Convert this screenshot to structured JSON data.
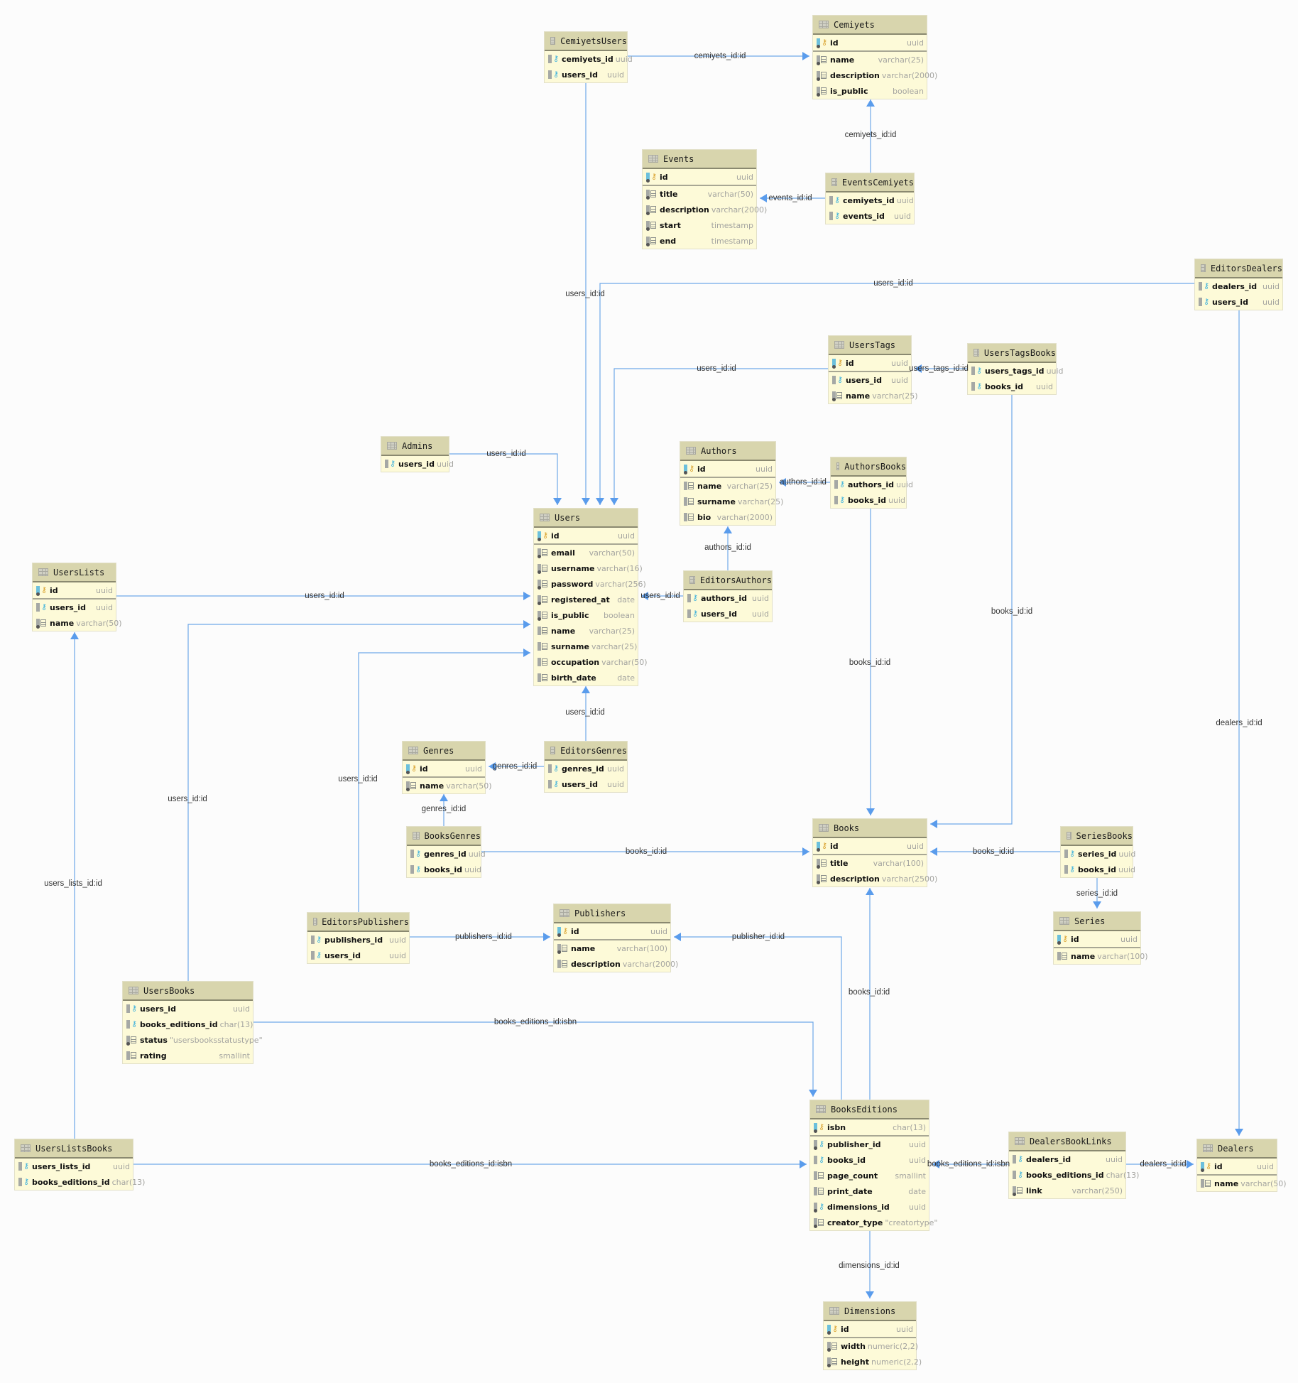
{
  "diagram": {
    "type": "database-er-diagram",
    "colors": {
      "edge": "#6fa8e8",
      "arrow": "#5a9cec",
      "header": "#d8d5ad",
      "body": "#fdfad8"
    },
    "tables": [
      {
        "name": "CemiyetsUsers",
        "columns": [
          {
            "name": "cemiyets_id",
            "type": "uuid",
            "kind": "fk"
          },
          {
            "name": "users_id",
            "type": "uuid",
            "kind": "fk"
          }
        ]
      },
      {
        "name": "Cemiyets",
        "columns": [
          {
            "name": "id",
            "type": "uuid",
            "kind": "pk"
          },
          {
            "name": "name",
            "type": "varchar(25)",
            "kind": "col-req"
          },
          {
            "name": "description",
            "type": "varchar(2000)",
            "kind": "col-req"
          },
          {
            "name": "is_public",
            "type": "boolean",
            "kind": "col-req"
          }
        ]
      },
      {
        "name": "Events",
        "columns": [
          {
            "name": "id",
            "type": "uuid",
            "kind": "pk"
          },
          {
            "name": "title",
            "type": "varchar(50)",
            "kind": "col-req"
          },
          {
            "name": "description",
            "type": "varchar(2000)",
            "kind": "col-req"
          },
          {
            "name": "start",
            "type": "timestamp",
            "kind": "col-req"
          },
          {
            "name": "end",
            "type": "timestamp",
            "kind": "col-req"
          }
        ]
      },
      {
        "name": "EventsCemiyets",
        "columns": [
          {
            "name": "cemiyets_id",
            "type": "uuid",
            "kind": "fk"
          },
          {
            "name": "events_id",
            "type": "uuid",
            "kind": "fk"
          }
        ]
      },
      {
        "name": "EditorsDealers",
        "columns": [
          {
            "name": "dealers_id",
            "type": "uuid",
            "kind": "fk"
          },
          {
            "name": "users_id",
            "type": "uuid",
            "kind": "fk"
          }
        ]
      },
      {
        "name": "UsersTags",
        "columns": [
          {
            "name": "id",
            "type": "uuid",
            "kind": "pk"
          },
          {
            "name": "users_id",
            "type": "uuid",
            "kind": "fk"
          },
          {
            "name": "name",
            "type": "varchar(25)",
            "kind": "col-req"
          }
        ]
      },
      {
        "name": "UsersTagsBooks",
        "columns": [
          {
            "name": "users_tags_id",
            "type": "uuid",
            "kind": "fk"
          },
          {
            "name": "books_id",
            "type": "uuid",
            "kind": "fk"
          }
        ]
      },
      {
        "name": "Admins",
        "columns": [
          {
            "name": "users_id",
            "type": "uuid",
            "kind": "fk"
          }
        ]
      },
      {
        "name": "Authors",
        "columns": [
          {
            "name": "id",
            "type": "uuid",
            "kind": "pk"
          },
          {
            "name": "name",
            "type": "varchar(25)",
            "kind": "col"
          },
          {
            "name": "surname",
            "type": "varchar(25)",
            "kind": "col"
          },
          {
            "name": "bio",
            "type": "varchar(2000)",
            "kind": "col"
          }
        ]
      },
      {
        "name": "AuthorsBooks",
        "columns": [
          {
            "name": "authors_id",
            "type": "uuid",
            "kind": "fk"
          },
          {
            "name": "books_id",
            "type": "uuid",
            "kind": "fk"
          }
        ]
      },
      {
        "name": "Users",
        "columns": [
          {
            "name": "id",
            "type": "uuid",
            "kind": "pk"
          },
          {
            "name": "email",
            "type": "varchar(50)",
            "kind": "col-req"
          },
          {
            "name": "username",
            "type": "varchar(16)",
            "kind": "col-req"
          },
          {
            "name": "password",
            "type": "varchar(256)",
            "kind": "col-req"
          },
          {
            "name": "registered_at",
            "type": "date",
            "kind": "col-req"
          },
          {
            "name": "is_public",
            "type": "boolean",
            "kind": "col-req"
          },
          {
            "name": "name",
            "type": "varchar(25)",
            "kind": "col"
          },
          {
            "name": "surname",
            "type": "varchar(25)",
            "kind": "col"
          },
          {
            "name": "occupation",
            "type": "varchar(50)",
            "kind": "col"
          },
          {
            "name": "birth_date",
            "type": "date",
            "kind": "col"
          }
        ]
      },
      {
        "name": "EditorsAuthors",
        "columns": [
          {
            "name": "authors_id",
            "type": "uuid",
            "kind": "fk"
          },
          {
            "name": "users_id",
            "type": "uuid",
            "kind": "fk"
          }
        ]
      },
      {
        "name": "UsersLists",
        "columns": [
          {
            "name": "id",
            "type": "uuid",
            "kind": "pk"
          },
          {
            "name": "users_id",
            "type": "uuid",
            "kind": "fk"
          },
          {
            "name": "name",
            "type": "varchar(50)",
            "kind": "col-req"
          }
        ]
      },
      {
        "name": "Genres",
        "columns": [
          {
            "name": "id",
            "type": "uuid",
            "kind": "pk"
          },
          {
            "name": "name",
            "type": "varchar(50)",
            "kind": "col-req"
          }
        ]
      },
      {
        "name": "EditorsGenres",
        "columns": [
          {
            "name": "genres_id",
            "type": "uuid",
            "kind": "fk"
          },
          {
            "name": "users_id",
            "type": "uuid",
            "kind": "fk"
          }
        ]
      },
      {
        "name": "BooksGenres",
        "columns": [
          {
            "name": "genres_id",
            "type": "uuid",
            "kind": "fk"
          },
          {
            "name": "books_id",
            "type": "uuid",
            "kind": "fk"
          }
        ]
      },
      {
        "name": "Books",
        "columns": [
          {
            "name": "id",
            "type": "uuid",
            "kind": "pk"
          },
          {
            "name": "title",
            "type": "varchar(100)",
            "kind": "col-req"
          },
          {
            "name": "description",
            "type": "varchar(2500)",
            "kind": "col-req"
          }
        ]
      },
      {
        "name": "SeriesBooks",
        "columns": [
          {
            "name": "series_id",
            "type": "uuid",
            "kind": "fk"
          },
          {
            "name": "books_id",
            "type": "uuid",
            "kind": "fk"
          }
        ]
      },
      {
        "name": "Series",
        "columns": [
          {
            "name": "id",
            "type": "uuid",
            "kind": "pk"
          },
          {
            "name": "name",
            "type": "varchar(100)",
            "kind": "col"
          }
        ]
      },
      {
        "name": "EditorsPublishers",
        "columns": [
          {
            "name": "publishers_id",
            "type": "uuid",
            "kind": "fk"
          },
          {
            "name": "users_id",
            "type": "uuid",
            "kind": "fk"
          }
        ]
      },
      {
        "name": "Publishers",
        "columns": [
          {
            "name": "id",
            "type": "uuid",
            "kind": "pk"
          },
          {
            "name": "name",
            "type": "varchar(100)",
            "kind": "col-req"
          },
          {
            "name": "description",
            "type": "varchar(2000)",
            "kind": "col"
          }
        ]
      },
      {
        "name": "UsersBooks",
        "columns": [
          {
            "name": "users_id",
            "type": "uuid",
            "kind": "fk"
          },
          {
            "name": "books_editions_id",
            "type": "char(13)",
            "kind": "fk"
          },
          {
            "name": "status",
            "type": "\"usersbooksstatustype\"",
            "kind": "col-req"
          },
          {
            "name": "rating",
            "type": "smallint",
            "kind": "col"
          }
        ]
      },
      {
        "name": "BooksEditions",
        "columns": [
          {
            "name": "isbn",
            "type": "char(13)",
            "kind": "pk"
          },
          {
            "name": "publisher_id",
            "type": "uuid",
            "kind": "fk-req"
          },
          {
            "name": "books_id",
            "type": "uuid",
            "kind": "fk"
          },
          {
            "name": "page_count",
            "type": "smallint",
            "kind": "col"
          },
          {
            "name": "print_date",
            "type": "date",
            "kind": "col"
          },
          {
            "name": "dimensions_id",
            "type": "uuid",
            "kind": "fk-req"
          },
          {
            "name": "creator_type",
            "type": "\"creatortype\"",
            "kind": "col-req"
          }
        ]
      },
      {
        "name": "DealersBookLinks",
        "columns": [
          {
            "name": "dealers_id",
            "type": "uuid",
            "kind": "fk"
          },
          {
            "name": "books_editions_id",
            "type": "char(13)",
            "kind": "fk"
          },
          {
            "name": "link",
            "type": "varchar(250)",
            "kind": "col-req"
          }
        ]
      },
      {
        "name": "Dealers",
        "columns": [
          {
            "name": "id",
            "type": "uuid",
            "kind": "pk"
          },
          {
            "name": "name",
            "type": "varchar(50)",
            "kind": "col"
          }
        ]
      },
      {
        "name": "UsersListsBooks",
        "columns": [
          {
            "name": "users_lists_id",
            "type": "uuid",
            "kind": "fk"
          },
          {
            "name": "books_editions_id",
            "type": "char(13)",
            "kind": "fk"
          }
        ]
      },
      {
        "name": "Dimensions",
        "columns": [
          {
            "name": "id",
            "type": "uuid",
            "kind": "pk"
          },
          {
            "name": "width",
            "type": "numeric(2,2)",
            "kind": "col-req"
          },
          {
            "name": "height",
            "type": "numeric(2,2)",
            "kind": "col-req"
          }
        ]
      }
    ],
    "relations": [
      {
        "from": "CemiyetsUsers",
        "to": "Cemiyets",
        "label": "cemiyets_id:id"
      },
      {
        "from": "CemiyetsUsers",
        "to": "Users",
        "label": "users_id:id"
      },
      {
        "from": "EventsCemiyets",
        "to": "Cemiyets",
        "label": "cemiyets_id:id"
      },
      {
        "from": "EventsCemiyets",
        "to": "Events",
        "label": "events_id:id"
      },
      {
        "from": "EditorsDealers",
        "to": "Users",
        "label": "users_id:id"
      },
      {
        "from": "EditorsDealers",
        "to": "Dealers",
        "label": "dealers_id:id"
      },
      {
        "from": "UsersTags",
        "to": "Users",
        "label": "users_id:id"
      },
      {
        "from": "UsersTagsBooks",
        "to": "UsersTags",
        "label": "users_tags_id:id"
      },
      {
        "from": "UsersTagsBooks",
        "to": "Books",
        "label": "books_id:id"
      },
      {
        "from": "Admins",
        "to": "Users",
        "label": "users_id:id"
      },
      {
        "from": "AuthorsBooks",
        "to": "Authors",
        "label": "authors_id:id"
      },
      {
        "from": "AuthorsBooks",
        "to": "Books",
        "label": "books_id:id"
      },
      {
        "from": "EditorsAuthors",
        "to": "Authors",
        "label": "authors_id:id"
      },
      {
        "from": "EditorsAuthors",
        "to": "Users",
        "label": "users_id:id"
      },
      {
        "from": "UsersLists",
        "to": "Users",
        "label": "users_id:id"
      },
      {
        "from": "UsersBooks",
        "to": "Users",
        "label": "users_id:id"
      },
      {
        "from": "EditorsPublishers",
        "to": "Users",
        "label": "users_id:id"
      },
      {
        "from": "EditorsGenres",
        "to": "Users",
        "label": "users_id:id"
      },
      {
        "from": "EditorsGenres",
        "to": "Genres",
        "label": "genres_id:id"
      },
      {
        "from": "BooksGenres",
        "to": "Genres",
        "label": "genres_id:id"
      },
      {
        "from": "BooksGenres",
        "to": "Books",
        "label": "books_id:id"
      },
      {
        "from": "SeriesBooks",
        "to": "Books",
        "label": "books_id:id"
      },
      {
        "from": "SeriesBooks",
        "to": "Series",
        "label": "series_id:id"
      },
      {
        "from": "EditorsPublishers",
        "to": "Publishers",
        "label": "publishers_id:id"
      },
      {
        "from": "BooksEditions",
        "to": "Publishers",
        "label": "publisher_id:id"
      },
      {
        "from": "BooksEditions",
        "to": "Books",
        "label": "books_id:id"
      },
      {
        "from": "UsersBooks",
        "to": "BooksEditions",
        "label": "books_editions_id:isbn"
      },
      {
        "from": "UsersListsBooks",
        "to": "UsersLists",
        "label": "users_lists_id:id"
      },
      {
        "from": "UsersListsBooks",
        "to": "BooksEditions",
        "label": "books_editions_id:isbn"
      },
      {
        "from": "DealersBookLinks",
        "to": "BooksEditions",
        "label": "books_editions_id:isbn"
      },
      {
        "from": "DealersBookLinks",
        "to": "Dealers",
        "label": "dealers_id:id"
      },
      {
        "from": "BooksEditions",
        "to": "Dimensions",
        "label": "dimensions_id:id"
      }
    ]
  }
}
